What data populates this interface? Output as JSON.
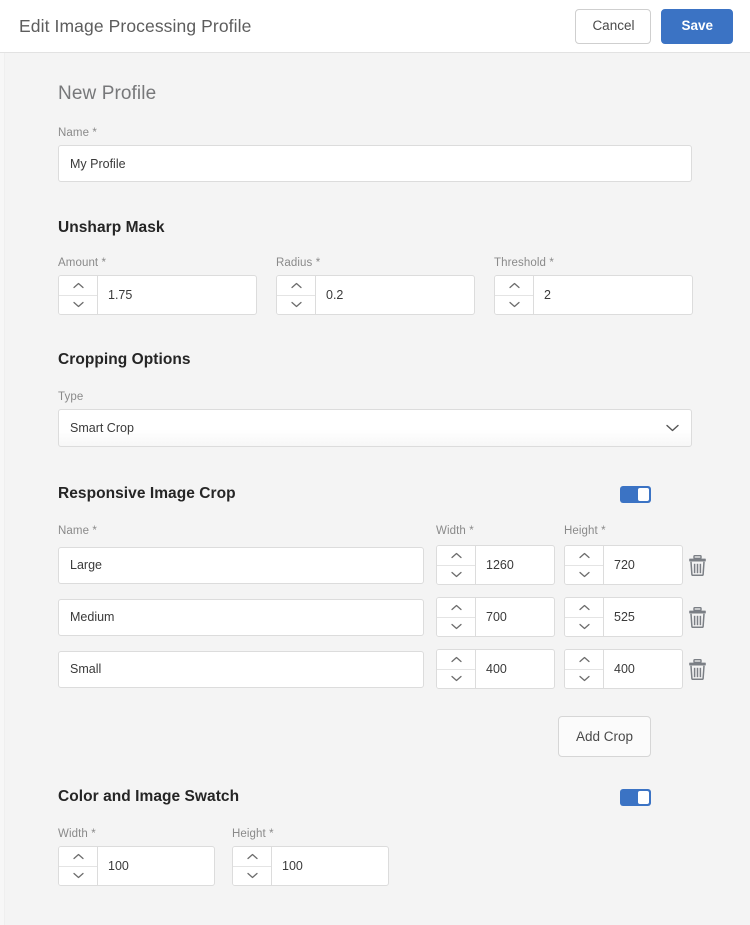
{
  "header": {
    "title": "Edit Image Processing Profile",
    "cancel_label": "Cancel",
    "save_label": "Save"
  },
  "colors": {
    "accent": "#3b73c4",
    "page_bg": "#f4f4f4",
    "header_bg": "#ffffff",
    "input_border": "#dcdcdc",
    "label_text": "#8a8a8a",
    "heading_text": "#252525"
  },
  "profile": {
    "heading": "New Profile",
    "name_label": "Name *",
    "name_value": "My Profile",
    "name_placeholder": ""
  },
  "unsharp_mask": {
    "heading": "Unsharp Mask",
    "fields": [
      {
        "label": "Amount *",
        "value": "1.75"
      },
      {
        "label": "Radius *",
        "value": "0.2"
      },
      {
        "label": "Threshold *",
        "value": "2"
      }
    ]
  },
  "cropping_options": {
    "heading": "Cropping Options",
    "type_label": "Type",
    "type_value": "Smart Crop",
    "type_options": [
      "Smart Crop"
    ]
  },
  "responsive_image_crop": {
    "heading": "Responsive Image Crop",
    "enabled": true,
    "columns": {
      "name": "Name *",
      "width": "Width *",
      "height": "Height *"
    },
    "rows": [
      {
        "name": "Large",
        "width": "1260",
        "height": "720"
      },
      {
        "name": "Medium",
        "width": "700",
        "height": "525"
      },
      {
        "name": "Small",
        "width": "400",
        "height": "400"
      }
    ],
    "add_crop_label": "Add Crop",
    "delete_icon": "trash-icon"
  },
  "color_image_swatch": {
    "heading": "Color and Image Swatch",
    "enabled": true,
    "fields": [
      {
        "label": "Width *",
        "value": "100"
      },
      {
        "label": "Height *",
        "value": "100"
      }
    ]
  },
  "icons": {
    "stepper_up": "chevron-up-icon",
    "stepper_down": "chevron-down-icon",
    "select_caret": "chevron-down-icon",
    "delete": "trash-icon"
  }
}
